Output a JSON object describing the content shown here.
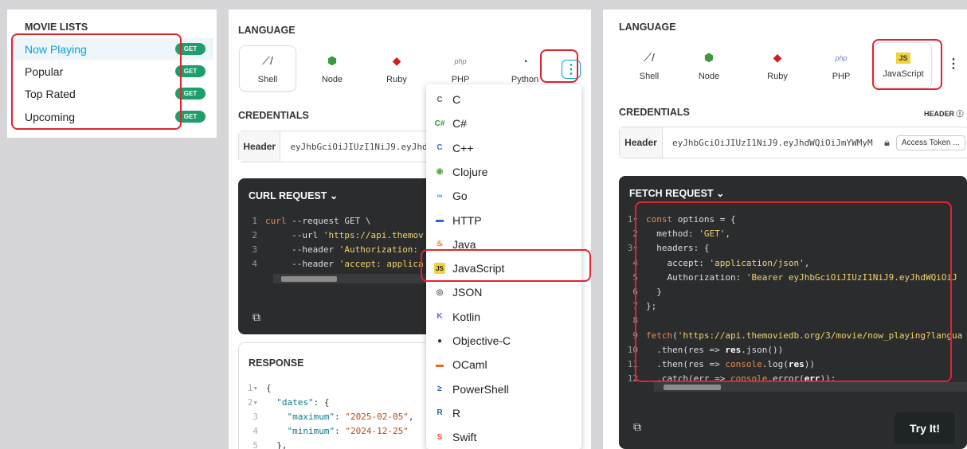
{
  "movie_lists": {
    "title": "MOVIE LISTS",
    "badge": "GET",
    "items": [
      {
        "label": "Now Playing",
        "active": true
      },
      {
        "label": "Popular",
        "active": false
      },
      {
        "label": "Top Rated",
        "active": false
      },
      {
        "label": "Upcoming",
        "active": false
      }
    ]
  },
  "middle": {
    "language_title": "LANGUAGE",
    "languages": [
      {
        "label": "Shell",
        "icon": "shell-icon",
        "glyph": "⟋/"
      },
      {
        "label": "Node",
        "icon": "node-icon",
        "glyph": "⬢"
      },
      {
        "label": "Ruby",
        "icon": "ruby-icon",
        "glyph": "◆"
      },
      {
        "label": "PHP",
        "icon": "php-icon",
        "glyph": "php"
      },
      {
        "label": "Python",
        "icon": "python-icon",
        "glyph": "◔"
      }
    ],
    "more_glyph": "⋮",
    "credentials_title": "CREDENTIALS",
    "header_label": "Header",
    "token": "eyJhbGciOiJIUzI1NiJ9.eyJhdW",
    "curl_title": "CURL REQUEST ⌄",
    "curl_lines": [
      {
        "n": "1",
        "parts": [
          [
            "kw",
            "curl"
          ],
          [
            "t",
            " --request GET \\"
          ]
        ]
      },
      {
        "n": "2",
        "parts": [
          [
            "t",
            "     --url "
          ],
          [
            "str",
            "'https://api.themov"
          ]
        ]
      },
      {
        "n": "3",
        "parts": [
          [
            "t",
            "     --header "
          ],
          [
            "str",
            "'Authorization:"
          ]
        ]
      },
      {
        "n": "4",
        "parts": [
          [
            "t",
            "     --header "
          ],
          [
            "str",
            "'accept: applica"
          ]
        ]
      }
    ],
    "response_title": "RESPONSE",
    "response_lines": [
      {
        "n": "1▾",
        "parts": [
          [
            "t",
            "{"
          ]
        ]
      },
      {
        "n": "2▾",
        "parts": [
          [
            "t",
            "  "
          ],
          [
            "k",
            "\"dates\""
          ],
          [
            "t",
            ": {"
          ]
        ]
      },
      {
        "n": "3",
        "parts": [
          [
            "t",
            "    "
          ],
          [
            "k",
            "\"maximum\""
          ],
          [
            "t",
            ": "
          ],
          [
            "s",
            "\"2025-02-05\""
          ],
          [
            "t",
            ","
          ]
        ]
      },
      {
        "n": "4",
        "parts": [
          [
            "t",
            "    "
          ],
          [
            "k",
            "\"minimum\""
          ],
          [
            "t",
            ": "
          ],
          [
            "s",
            "\"2024-12-25\""
          ]
        ]
      },
      {
        "n": "5",
        "parts": [
          [
            "t",
            "  },"
          ]
        ]
      }
    ]
  },
  "dropdown": {
    "items": [
      {
        "label": "C",
        "icon": "c-icon",
        "glyph": "C",
        "color": "#5a6b7a"
      },
      {
        "label": "C#",
        "icon": "csharp-icon",
        "glyph": "C#",
        "color": "#1e9e3a"
      },
      {
        "label": "C++",
        "icon": "cpp-icon",
        "glyph": "C",
        "color": "#3a6fc4"
      },
      {
        "label": "Clojure",
        "icon": "clojure-icon",
        "glyph": "◉",
        "color": "#5fa84a"
      },
      {
        "label": "Go",
        "icon": "go-icon",
        "glyph": "∞",
        "color": "#29a7d8"
      },
      {
        "label": "HTTP",
        "icon": "http-icon",
        "glyph": "▬",
        "color": "#1f6fc4"
      },
      {
        "label": "Java",
        "icon": "java-icon",
        "glyph": "♨",
        "color": "#e76f00"
      },
      {
        "label": "JavaScript",
        "icon": "javascript-icon",
        "glyph": "JS",
        "color": "#f0d23a"
      },
      {
        "label": "JSON",
        "icon": "json-icon",
        "glyph": "◎",
        "color": "#666"
      },
      {
        "label": "Kotlin",
        "icon": "kotlin-icon",
        "glyph": "K",
        "color": "#7f52ff"
      },
      {
        "label": "Objective-C",
        "icon": "apple-icon",
        "glyph": "●",
        "color": "#333"
      },
      {
        "label": "OCaml",
        "icon": "ocaml-icon",
        "glyph": "▬",
        "color": "#ee6a1a"
      },
      {
        "label": "PowerShell",
        "icon": "powershell-icon",
        "glyph": "≥",
        "color": "#2a5ea8"
      },
      {
        "label": "R",
        "icon": "r-icon",
        "glyph": "R",
        "color": "#2266b8"
      },
      {
        "label": "Swift",
        "icon": "swift-icon",
        "glyph": "S",
        "color": "#f05138"
      }
    ]
  },
  "right": {
    "language_title": "LANGUAGE",
    "languages": [
      {
        "label": "Shell",
        "icon": "shell-icon",
        "glyph": "⟋/"
      },
      {
        "label": "Node",
        "icon": "node-icon",
        "glyph": "⬢"
      },
      {
        "label": "Ruby",
        "icon": "ruby-icon",
        "glyph": "◆"
      },
      {
        "label": "PHP",
        "icon": "php-icon",
        "glyph": "php"
      },
      {
        "label": "JavaScript",
        "icon": "javascript-icon",
        "glyph": "JS"
      }
    ],
    "more_glyph": "⋮",
    "credentials_title": "CREDENTIALS",
    "header_link": "HEADER ⓘ",
    "header_label": "Header",
    "token": "eyJhbGciOiJIUzI1NiJ9.eyJhdWQiOiJmYWMyM",
    "access_token": "Access Token ...",
    "fetch_title": "FETCH REQUEST ⌄",
    "fetch_lines": [
      {
        "n": "1▾",
        "parts": [
          [
            "kw",
            "const"
          ],
          [
            "t",
            " options = {"
          ]
        ]
      },
      {
        "n": "2",
        "parts": [
          [
            "t",
            "  method: "
          ],
          [
            "str",
            "'GET'"
          ],
          [
            "t",
            ","
          ]
        ]
      },
      {
        "n": "3▾",
        "parts": [
          [
            "t",
            "  headers: {"
          ]
        ]
      },
      {
        "n": "4",
        "parts": [
          [
            "t",
            "    accept: "
          ],
          [
            "str",
            "'application/json'"
          ],
          [
            "t",
            ","
          ]
        ]
      },
      {
        "n": "5",
        "parts": [
          [
            "t",
            "    Authorization: "
          ],
          [
            "str",
            "'Bearer eyJhbGciOiJIUzI1NiJ9.eyJhdWQiOiJ"
          ]
        ]
      },
      {
        "n": "6",
        "parts": [
          [
            "t",
            "  }"
          ]
        ]
      },
      {
        "n": "7",
        "parts": [
          [
            "t",
            "};"
          ]
        ]
      },
      {
        "n": "8",
        "parts": [
          [
            "t",
            ""
          ]
        ]
      },
      {
        "n": "9",
        "parts": [
          [
            "kw",
            "fetch"
          ],
          [
            "t",
            "("
          ],
          [
            "str",
            "'https://api.themoviedb.org/3/movie/now_playing?langua"
          ]
        ]
      },
      {
        "n": "10",
        "parts": [
          [
            "t",
            "  .then(res => "
          ],
          [
            "fn",
            "res"
          ],
          [
            "t",
            ".json())"
          ]
        ]
      },
      {
        "n": "11",
        "parts": [
          [
            "t",
            "  .then(res => "
          ],
          [
            "kw",
            "console"
          ],
          [
            "t",
            ".log("
          ],
          [
            "fn",
            "res"
          ],
          [
            "t",
            "))"
          ]
        ]
      },
      {
        "n": "12",
        "parts": [
          [
            "t",
            "  .catch(err => "
          ],
          [
            "kw",
            "console"
          ],
          [
            "t",
            ".error("
          ],
          [
            "fn",
            "err"
          ],
          [
            "t",
            "));"
          ]
        ]
      }
    ],
    "try_it": "Try It!"
  }
}
